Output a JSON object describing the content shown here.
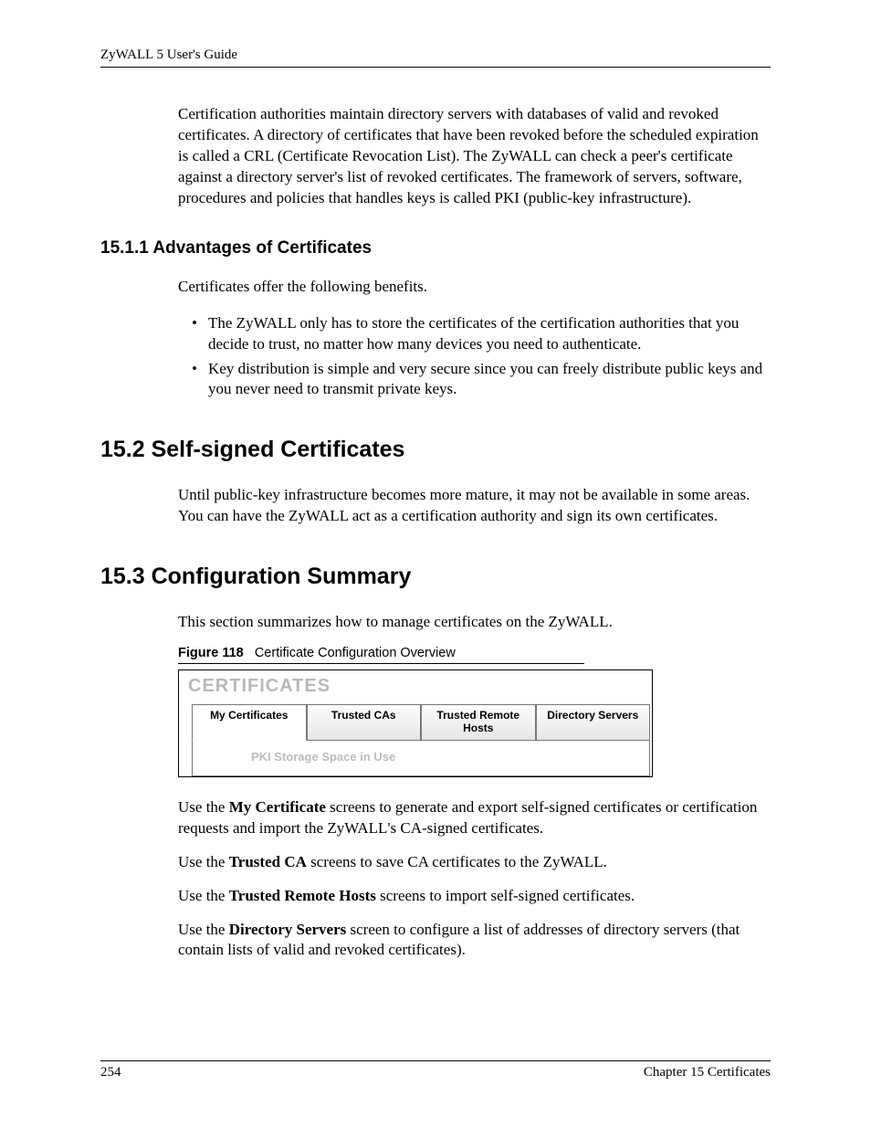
{
  "header": {
    "title": "ZyWALL 5 User's Guide"
  },
  "intro_para": "Certification authorities maintain directory servers with databases of valid and revoked certificates. A directory of certificates that have been revoked before the scheduled expiration is called a CRL (Certificate Revocation List). The ZyWALL can check a peer's certificate against a directory server's list of revoked certificates. The framework of servers, software, procedures and policies that handles keys is called PKI (public-key infrastructure).",
  "s1511": {
    "heading": "15.1.1  Advantages of Certificates",
    "intro": "Certificates offer the following benefits.",
    "bullets": [
      "The ZyWALL only has to store the certificates of the certification authorities that you decide to trust, no matter how many devices you need to authenticate.",
      "Key distribution is simple and very secure since you can freely distribute public keys and you never need to transmit private keys."
    ]
  },
  "s152": {
    "heading": "15.2  Self-signed Certificates",
    "para": "Until public-key infrastructure becomes more mature, it may not be available in some areas. You can have the ZyWALL act as a certification authority and sign its own certificates."
  },
  "s153": {
    "heading": "15.3  Configuration Summary",
    "intro": "This section summarizes how to manage certificates on the ZyWALL.",
    "figure": {
      "label": "Figure 118",
      "caption": "Certificate Configuration Overview",
      "panel_title": "CERTIFICATES",
      "tabs": [
        "My Certificates",
        "Trusted CAs",
        "Trusted Remote Hosts",
        "Directory Servers"
      ],
      "pki_text": "PKI Storage Space in Use"
    },
    "uses": [
      {
        "pre": "Use the ",
        "bold": "My Certificate",
        "post": " screens to generate and export self-signed certificates or certification requests and import the ZyWALL's CA-signed certificates."
      },
      {
        "pre": "Use the ",
        "bold": "Trusted CA",
        "post": " screens to save CA certificates to the ZyWALL."
      },
      {
        "pre": "Use the ",
        "bold": "Trusted Remote Hosts",
        "post": " screens to import self-signed certificates."
      },
      {
        "pre": "Use the ",
        "bold": "Directory Servers",
        "post": " screen to configure a list of addresses of directory servers (that contain lists of valid and revoked certificates)."
      }
    ]
  },
  "footer": {
    "page": "254",
    "chapter": "Chapter 15 Certificates"
  }
}
